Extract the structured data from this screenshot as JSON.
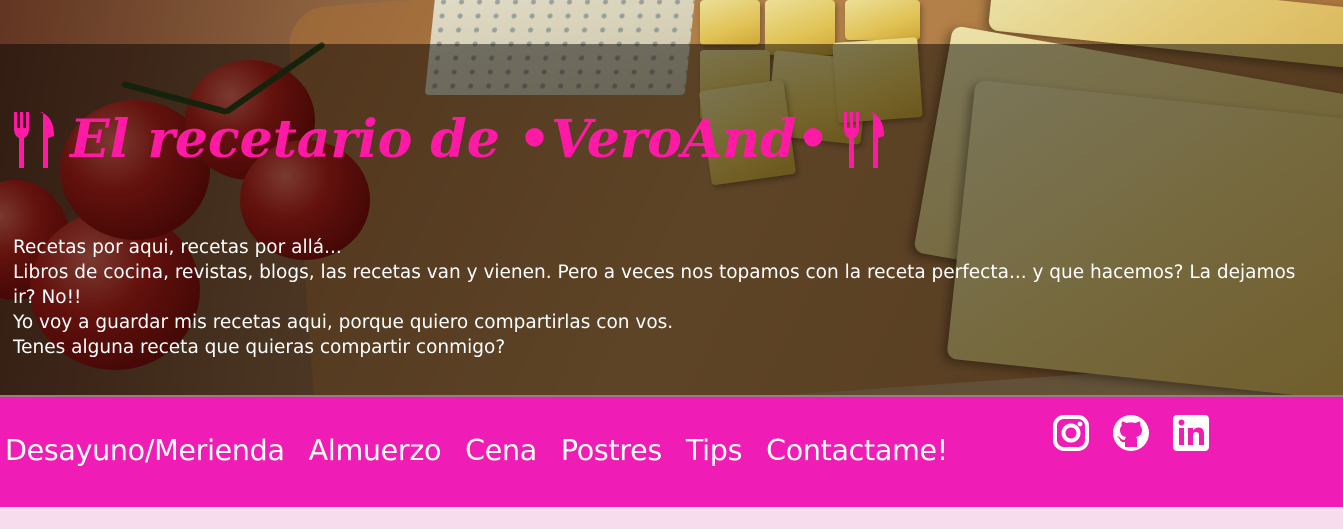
{
  "header": {
    "title": "El recetario de •VeroAnd•",
    "title_icon": "utensils-icon",
    "title_color": "#ff1aa6"
  },
  "intro": {
    "lines": [
      "Recetas por aqui, recetas por allá...",
      "Libros de cocina, revistas, blogs, las recetas van y vienen. Pero a veces nos topamos con la receta perfecta... y que hacemos? La dejamos ir? No!!",
      "Yo voy a guardar mis recetas aqui, porque quiero compartirlas con vos.",
      "Tenes alguna receta que quieras compartir conmigo?"
    ]
  },
  "nav": {
    "background": "#ef1cb5",
    "links": [
      {
        "label": "Desayuno/Merienda"
      },
      {
        "label": "Almuerzo"
      },
      {
        "label": "Cena"
      },
      {
        "label": "Postres"
      },
      {
        "label": "Tips"
      },
      {
        "label": "Contactame!"
      }
    ],
    "social": [
      {
        "icon": "instagram-icon"
      },
      {
        "icon": "github-icon"
      },
      {
        "icon": "linkedin-icon"
      }
    ]
  },
  "page": {
    "background": "#f6dcec"
  }
}
